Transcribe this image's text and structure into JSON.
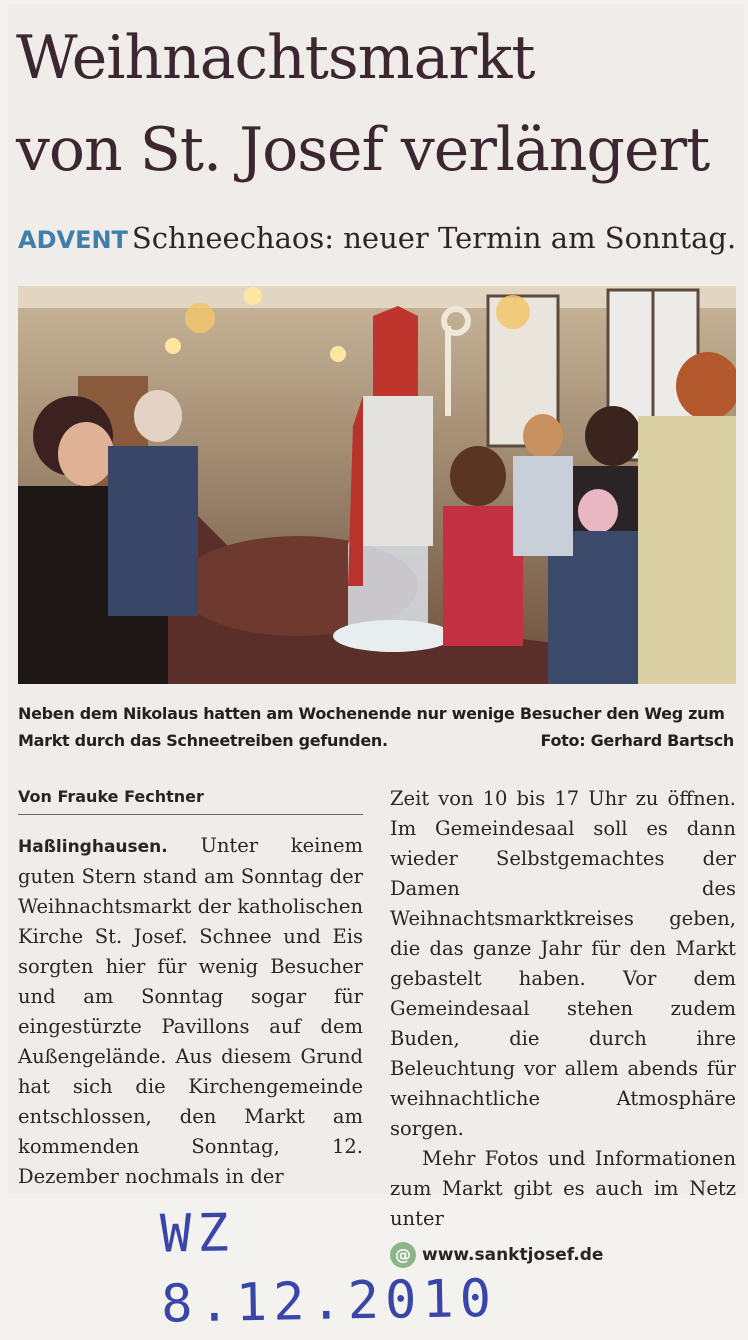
{
  "article": {
    "headline_line1": "Weihnachtsmarkt",
    "headline_line2": "von St. Josef verlängert",
    "kicker": "ADVENT",
    "subheadline": "Schneechaos: neuer Termin am Sonntag.",
    "caption": "Neben dem Nikolaus hatten am Wochenende nur wenige Besucher den Weg zum Markt durch das Schneetreiben gefunden.",
    "photo_credit": "Foto: Gerhard Bartsch",
    "author": "Von Frauke Fechtner",
    "place": "Haßlinghausen.",
    "body_left": "Unter keinem guten Stern stand am Sonntag der Weihnachtsmarkt der katholischen Kirche St. Josef. Schnee und Eis sorgten hier für wenig Besucher und am Sonntag sogar für eingestürzte Pavillons auf dem Außengelände. Aus diesem Grund hat sich die Kirchengemeinde entschlossen, den Markt am kommenden Sonntag, 12. Dezember nochmals in der",
    "body_right": "Zeit von 10 bis 17 Uhr zu öffnen. Im Gemeindesaal soll es dann wieder Selbstgemachtes der Damen des Weihnachtsmarktkreises geben, die das ganze Jahr für den Markt gebastelt haben. Vor dem Gemeindesaal stehen zudem Buden, die durch ihre Beleuchtung vor allem abends für weihnachtliche Atmosphäre sorgen.",
    "body_right_para2": "Mehr Fotos und Informationen zum Markt gibt es auch im Netz unter",
    "website": "www.sanktjosef.de",
    "web_icon_glyph": "@"
  },
  "annotation": {
    "handwritten_date": "WZ 8.12.2010"
  },
  "colors": {
    "kicker": "#3f7fa9",
    "headline": "#3b2730",
    "handwriting": "#3a45a8",
    "web_icon": "#8db58c"
  }
}
